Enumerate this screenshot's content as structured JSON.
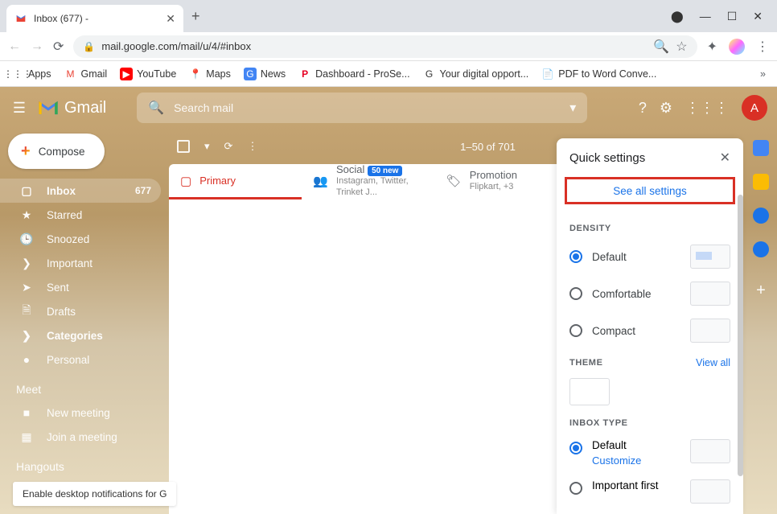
{
  "browser": {
    "tab_title": "Inbox (677) -",
    "url": "mail.google.com/mail/u/4/#inbox",
    "bookmarks": [
      {
        "label": "Apps",
        "icon": "⋮⋮⋮"
      },
      {
        "label": "Gmail",
        "icon": "M"
      },
      {
        "label": "YouTube",
        "icon": "▶"
      },
      {
        "label": "Maps",
        "icon": "📍"
      },
      {
        "label": "News",
        "icon": "📰"
      },
      {
        "label": "Dashboard - ProSe...",
        "icon": "P"
      },
      {
        "label": "Your digital opport...",
        "icon": "G"
      },
      {
        "label": "PDF to Word Conve...",
        "icon": "📄"
      }
    ]
  },
  "gmail": {
    "product": "Gmail",
    "search_placeholder": "Search mail",
    "avatar_letter": "A",
    "compose": "Compose",
    "nav": [
      {
        "icon": "▢",
        "label": "Inbox",
        "count": "677",
        "active": true
      },
      {
        "icon": "★",
        "label": "Starred"
      },
      {
        "icon": "🕒",
        "label": "Snoozed"
      },
      {
        "icon": "❯",
        "label": "Important"
      },
      {
        "icon": "➤",
        "label": "Sent"
      },
      {
        "icon": "🗎",
        "label": "Drafts"
      },
      {
        "icon": "❯",
        "label": "Categories",
        "bold": true
      },
      {
        "icon": "●",
        "label": "Personal"
      }
    ],
    "meet_heading": "Meet",
    "meet": [
      {
        "icon": "■",
        "label": "New meeting"
      },
      {
        "icon": "▦",
        "label": "Join a meeting"
      }
    ],
    "hangouts_heading": "Hangouts",
    "notification": "Enable desktop notifications for G",
    "toolbar": {
      "range": "1–50 of 701"
    },
    "tabs": [
      {
        "icon": "▢",
        "label": "Primary",
        "active": true
      },
      {
        "icon": "👥",
        "label": "Social",
        "badge": "50 new",
        "sub": "Instagram, Twitter, Trinket J..."
      },
      {
        "icon": "🏷",
        "label": "Promotion",
        "sub": "Flipkart, +3"
      }
    ]
  },
  "quick_settings": {
    "title": "Quick settings",
    "see_all": "See all settings",
    "density_heading": "DENSITY",
    "density": [
      {
        "label": "Default",
        "checked": true
      },
      {
        "label": "Comfortable"
      },
      {
        "label": "Compact"
      }
    ],
    "theme_heading": "THEME",
    "view_all": "View all",
    "inbox_heading": "INBOX TYPE",
    "inbox_types": [
      {
        "label": "Default",
        "sub": "Customize",
        "checked": true
      },
      {
        "label": "Important first"
      }
    ]
  }
}
